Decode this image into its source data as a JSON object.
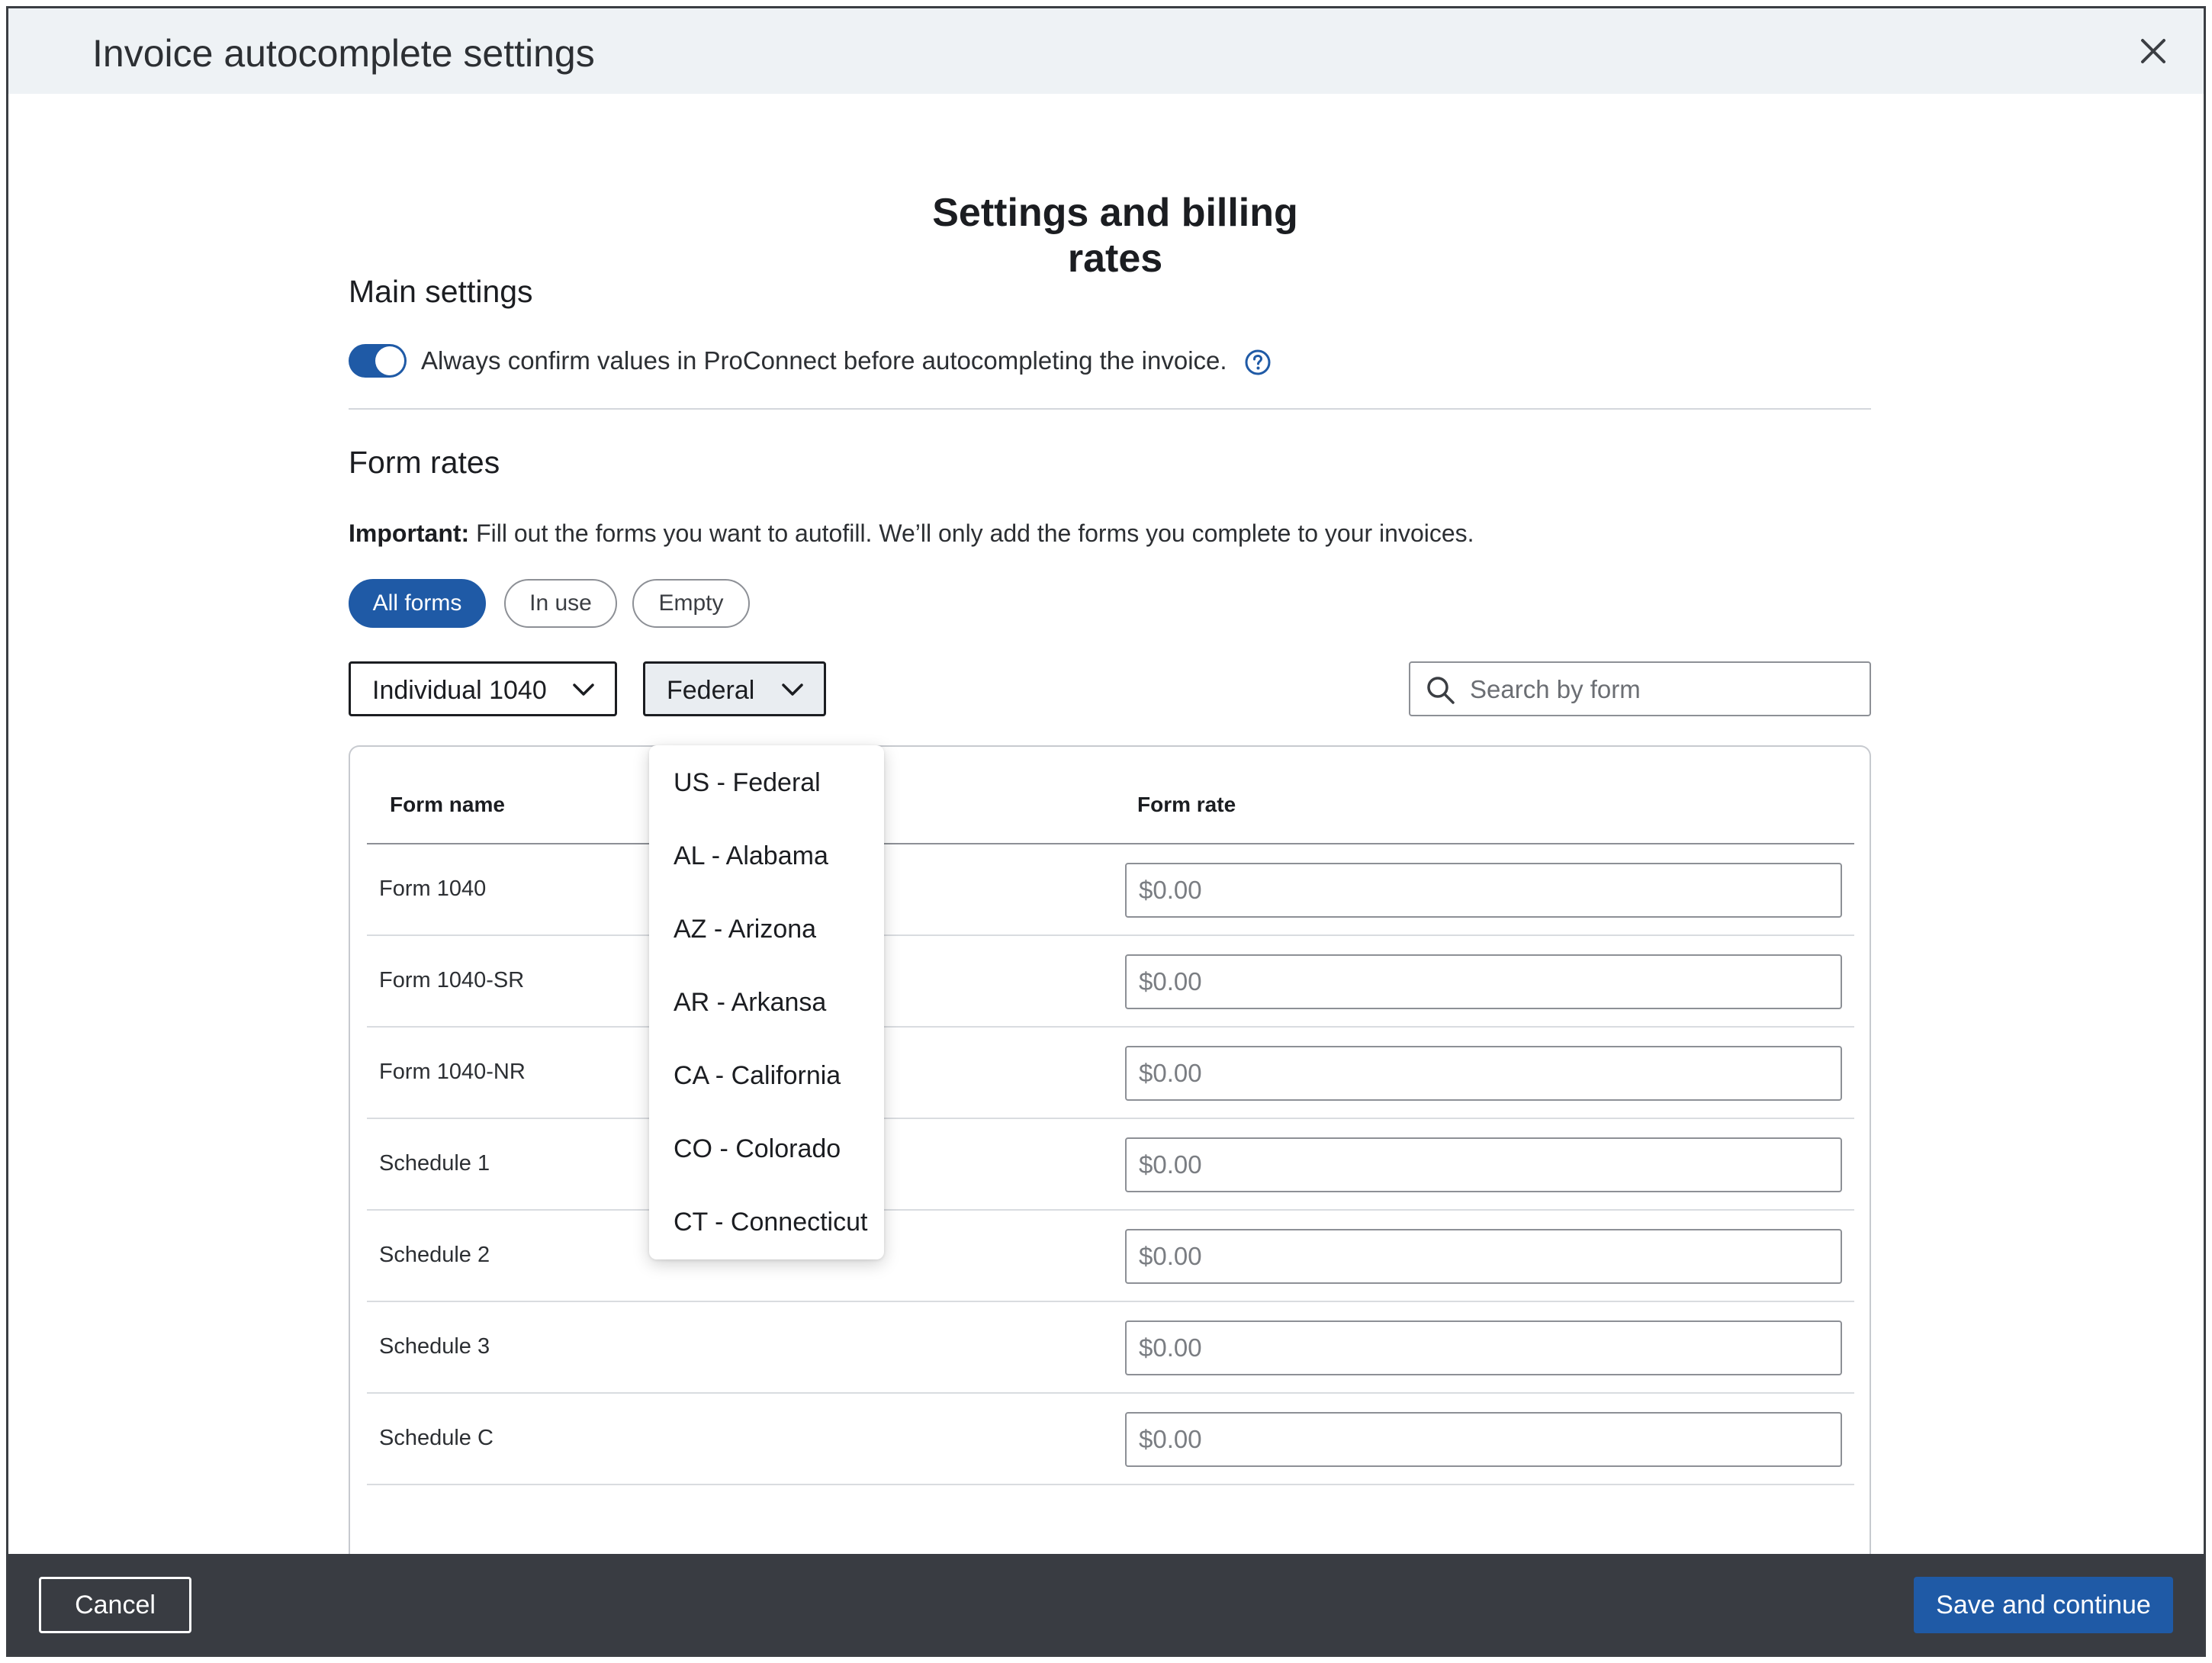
{
  "dialog": {
    "title": "Invoice autocomplete settings",
    "close_icon": "close-icon"
  },
  "page": {
    "heading": "Settings and billing rates"
  },
  "main_settings": {
    "heading": "Main settings",
    "toggle_on": true,
    "toggle_label": "Always confirm values in ProConnect before autocompleting the invoice.",
    "help_icon": "question-circle-icon"
  },
  "form_rates": {
    "heading": "Form rates",
    "note_bold": "Important:",
    "note_text": " Fill out the forms you want to autofill. We’ll only add the forms you complete to your invoices.",
    "filters": [
      {
        "label": "All forms",
        "active": true
      },
      {
        "label": "In use",
        "active": false
      },
      {
        "label": "Empty",
        "active": false
      }
    ],
    "form_type_select": "Individual 1040",
    "jurisdiction_select": "Federal",
    "search_placeholder": "Search by form",
    "table": {
      "columns": [
        "Form name",
        "Form rate"
      ],
      "rows": [
        {
          "name": "Form 1040",
          "rate_placeholder": "$0.00"
        },
        {
          "name": "Form 1040-SR",
          "rate_placeholder": "$0.00"
        },
        {
          "name": "Form 1040-NR",
          "rate_placeholder": "$0.00"
        },
        {
          "name": "Schedule 1",
          "rate_placeholder": "$0.00"
        },
        {
          "name": "Schedule 2",
          "rate_placeholder": "$0.00"
        },
        {
          "name": "Schedule 3",
          "rate_placeholder": "$0.00"
        },
        {
          "name": "Schedule C",
          "rate_placeholder": "$0.00"
        }
      ]
    },
    "jurisdiction_options": [
      "US - Federal",
      "AL - Alabama",
      "AZ - Arizona",
      "AR - Arkansa",
      "CA - California",
      "CO - Colorado",
      "CT - Connecticut"
    ]
  },
  "footer": {
    "cancel_label": "Cancel",
    "save_label": "Save and continue"
  },
  "colors": {
    "primary": "#1f5aa6",
    "header_bg": "#eef2f5",
    "footer_bg": "#393c42"
  }
}
